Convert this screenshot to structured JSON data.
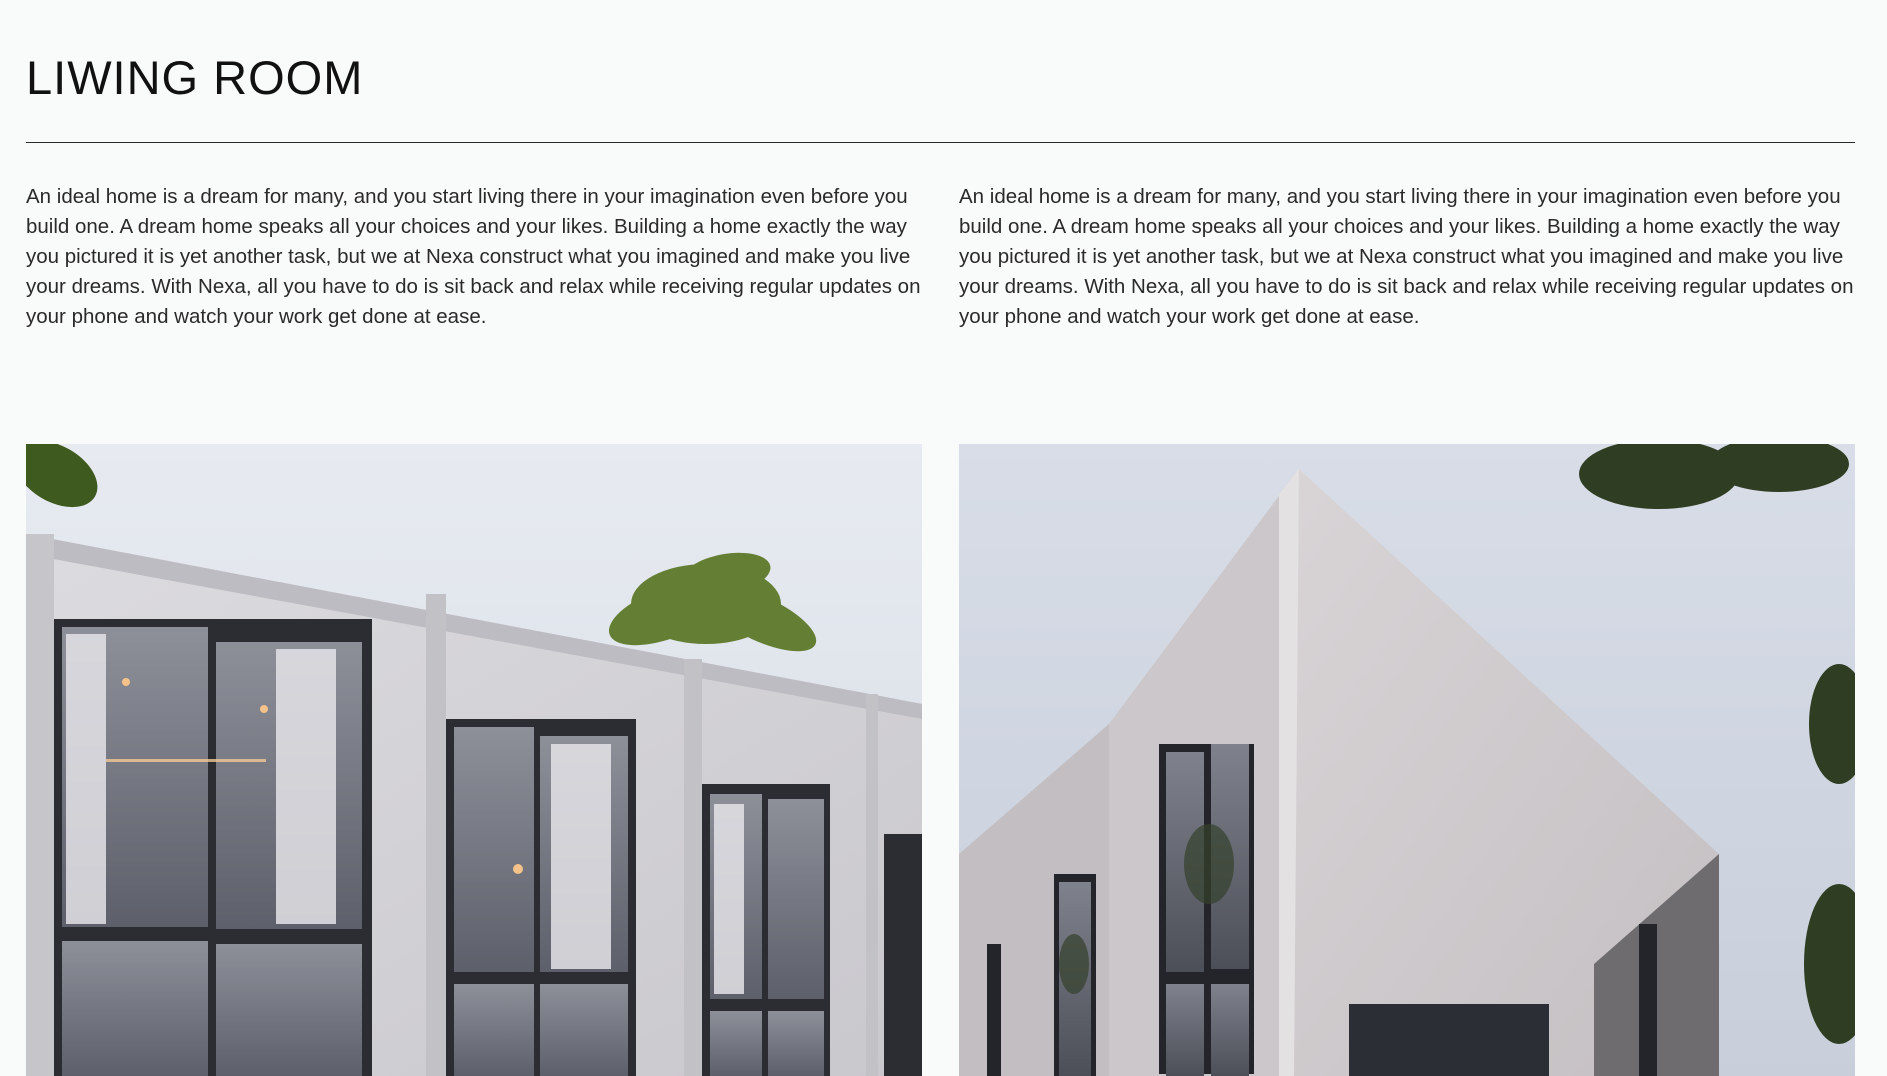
{
  "section": {
    "title": "LIWING ROOM"
  },
  "descriptions": [
    "An ideal home is a dream for many, and you start living there in your imagination even before you build one. A dream home speaks all your choices and your likes. Building a home exactly the way you pictured it is yet another task, but we at Nexa construct what you imagined and make you live your dreams. With Nexa, all you have to do is sit back and relax while receiving regular updates on your phone and watch your work get done at ease.",
    "An ideal home is a dream for many, and you start living there in your imagination even before you build one. A dream home speaks all your choices and your likes. Building a home exactly the way you pictured it is yet another task, but we at Nexa construct what you imagined and make you live your dreams. With Nexa, all you have to do is sit back and relax while receiving regular updates on your phone and watch your work get done at ease."
  ],
  "colors": {
    "background": "#f9fafa",
    "text": "#2a2a2a",
    "divider": "#2a2a2a",
    "sky": "#dfe4ec",
    "concrete": "#d4d3d6",
    "glass": "#6f727c",
    "foliage": "#5e7a2a"
  },
  "images": [
    {
      "name": "house-facade-photo"
    },
    {
      "name": "house-corner-photo"
    }
  ]
}
